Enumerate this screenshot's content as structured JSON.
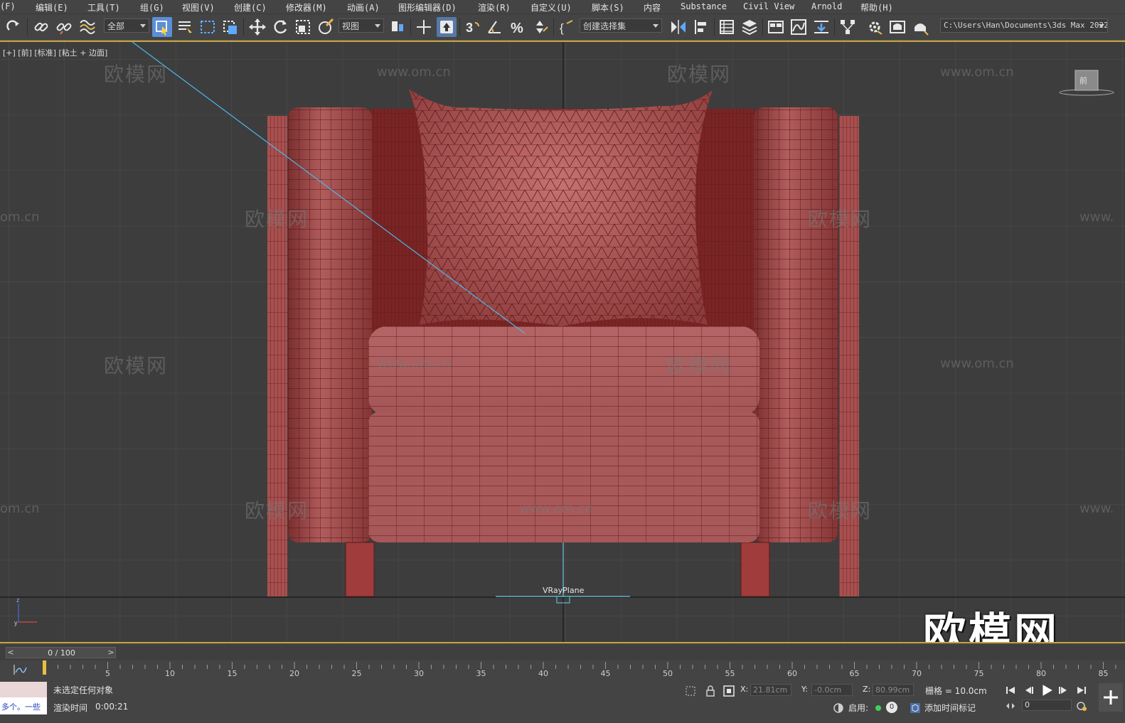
{
  "menu": [
    "(F)",
    "编辑(E)",
    "工具(T)",
    "组(G)",
    "视图(V)",
    "创建(C)",
    "修改器(M)",
    "动画(A)",
    "图形编辑器(D)",
    "渲染(R)",
    "自定义(U)",
    "脚本(S)",
    "内容",
    "Substance",
    "Civil View",
    "Arnold",
    "帮助(H)"
  ],
  "toolbar": {
    "filter_value": "全部",
    "refcoord_value": "视图",
    "selection_set_value": "创建选择集",
    "project_path": "C:\\Users\\Han\\Documents\\3ds Max 2022",
    "selection_icon": "select-object-icon",
    "active_color": "#5b8fd6"
  },
  "viewport": {
    "label": "[+] [前] [标准] [粘土 + 边面]",
    "object_label": "VRayPlane",
    "viewcube_label": "前",
    "watermark_cn": "欧模网",
    "watermark_url": "www.om.cn",
    "watermark_url_left": "om.cn",
    "watermark_url_right": "www.",
    "logo": "欧模网",
    "mesh_color": "#a04848",
    "grid_color": "#505050"
  },
  "timeline": {
    "frame_display": "0 / 100",
    "ticks": [
      "5",
      "10",
      "15",
      "20",
      "25",
      "30",
      "35",
      "40",
      "45",
      "50",
      "55",
      "60",
      "65",
      "70",
      "75",
      "80",
      "85"
    ]
  },
  "status": {
    "maxscript_text": "多个。一些",
    "selection_msg": "未选定任何对象",
    "render_time_label": "渲染时间",
    "render_time_value": "0:00:21",
    "x_label": "X:",
    "x_value": "21.81cm",
    "y_label": "Y:",
    "y_value": "-0.0cm",
    "z_label": "Z:",
    "z_value": "80.99cm",
    "grid_label": "栅格 = 10.0cm",
    "enable_label": "启用:",
    "enable_count": "0",
    "add_time_tag": "添加时间标记",
    "frame_value": "0"
  }
}
